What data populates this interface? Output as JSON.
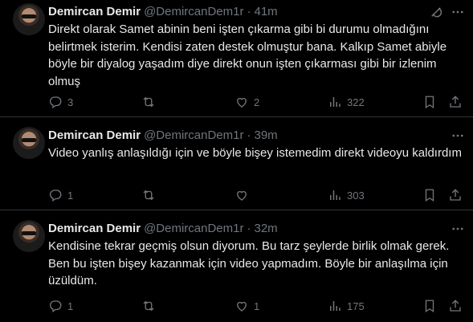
{
  "tweets": [
    {
      "name": "Demircan Demir",
      "handle": "@DemircanDem1r",
      "separator": "·",
      "time": "41m",
      "text": "Direkt olarak Samet abinin beni işten çıkarma gibi bi durumu olmadığını belirtmek isterim. Kendisi zaten destek olmuştur bana. Kalkıp Samet abiyle böyle bir diyalog yaşadım diye direkt onun işten çıkarması gibi bir izlenim olmuş",
      "replies": "3",
      "retweets": "",
      "likes": "2",
      "views": "322"
    },
    {
      "name": "Demircan Demir",
      "handle": "@DemircanDem1r",
      "separator": "·",
      "time": "39m",
      "text": "Video yanlış anlaşıldığı için ve böyle bişey istemedim direkt videoyu kaldırdım",
      "replies": "1",
      "retweets": "",
      "likes": "",
      "views": "303"
    },
    {
      "name": "Demircan Demir",
      "handle": "@DemircanDem1r",
      "separator": "·",
      "time": "32m",
      "text": "Kendisine tekrar geçmiş olsun diyorum. Bu tarz şeylerde birlik olmak gerek. Ben bu işten bişey kazanmak için video yapmadım. Böyle bir anlaşılma için üzüldüm.",
      "replies": "1",
      "retweets": "",
      "likes": "1",
      "views": "175"
    }
  ],
  "icons": {
    "grok": "grok-icon",
    "more": "more-icon",
    "reply": "reply-icon",
    "retweet": "retweet-icon",
    "like": "like-icon",
    "views": "views-icon",
    "bookmark": "bookmark-icon",
    "share": "share-icon"
  },
  "colors": {
    "background": "#000000",
    "text": "#e7e9ea",
    "muted": "#71767b",
    "divider": "#2f3336"
  }
}
